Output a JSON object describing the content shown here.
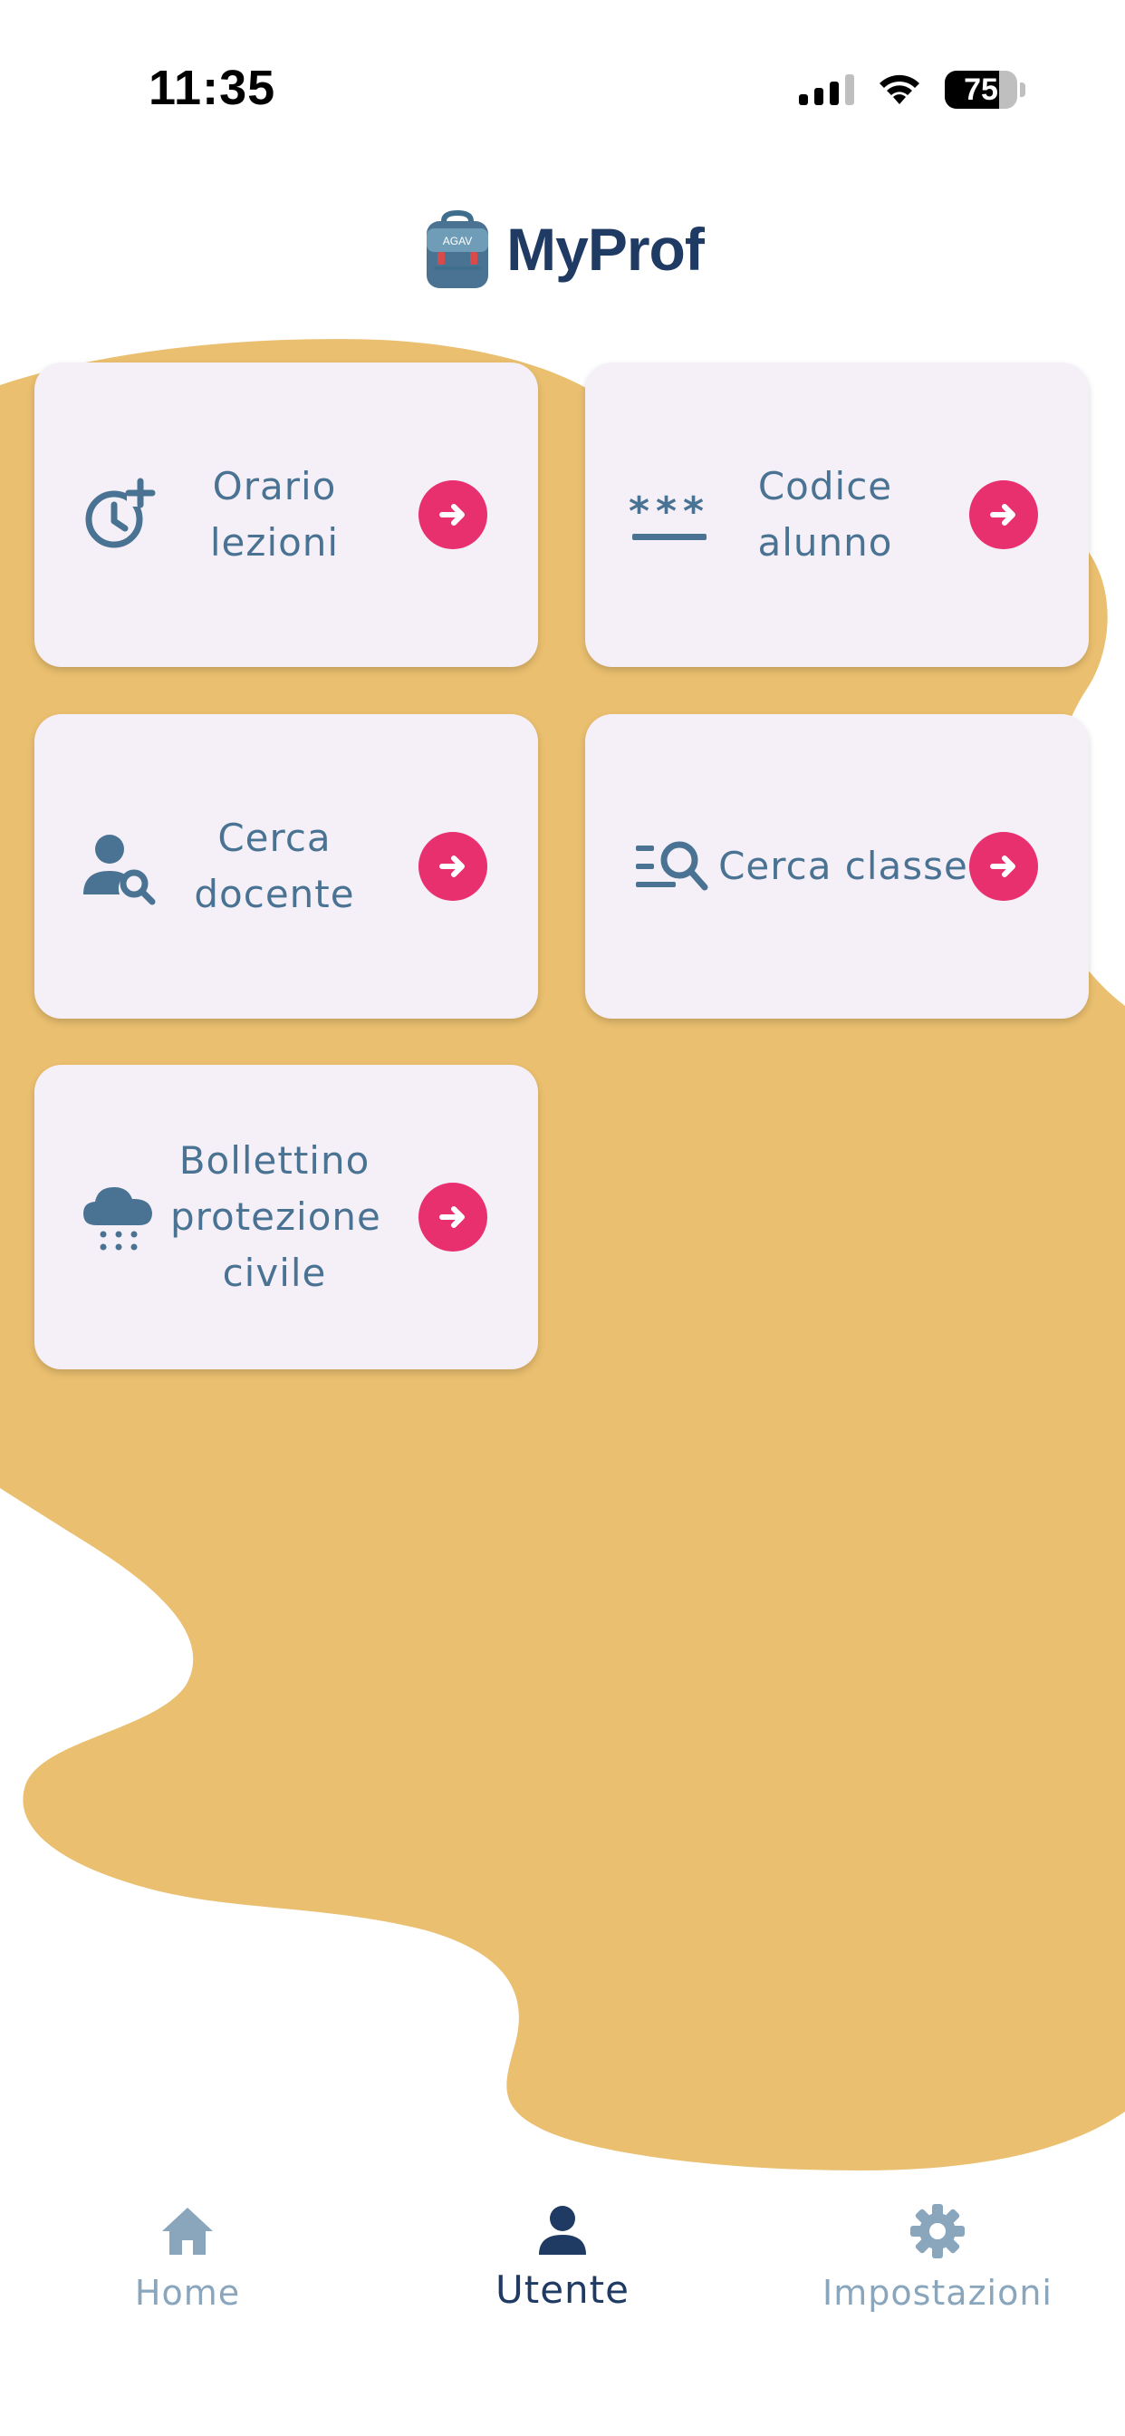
{
  "status_bar": {
    "time": "11:35",
    "battery_level": "75",
    "signal_bars": 3,
    "icons": [
      "cellular-signal-icon",
      "wifi-icon",
      "battery-icon"
    ]
  },
  "header": {
    "title": "MyProf",
    "logo_text": "AGAV",
    "logo_icon": "backpack-icon"
  },
  "cards": [
    {
      "label": "Orario lezioni",
      "icon": "clock-plus-icon",
      "arrow_icon": "arrow-right-circle-icon"
    },
    {
      "label": "Codice alunno",
      "icon": "password-icon",
      "arrow_icon": "arrow-right-circle-icon"
    },
    {
      "label": "Cerca docente",
      "icon": "person-search-icon",
      "arrow_icon": "arrow-right-circle-icon"
    },
    {
      "label": "Cerca classe",
      "icon": "list-search-icon",
      "arrow_icon": "arrow-right-circle-icon"
    },
    {
      "label": "Bollettino protezione civile",
      "icon": "cloud-snow-icon",
      "arrow_icon": "arrow-right-circle-icon"
    }
  ],
  "bottom_nav": {
    "items": [
      {
        "label": "Home",
        "icon": "home-icon",
        "active": false
      },
      {
        "label": "Utente",
        "icon": "person-icon",
        "active": true
      },
      {
        "label": "Impostazioni",
        "icon": "gear-icon",
        "active": false
      }
    ]
  },
  "colors": {
    "background": "#ffffff",
    "blob": "#eabf6f",
    "card": "#f5f0f8",
    "accent": "#e8306f",
    "icon": "#4a7393",
    "title": "#1f3b63",
    "nav_inactive": "#8aa6bd"
  }
}
